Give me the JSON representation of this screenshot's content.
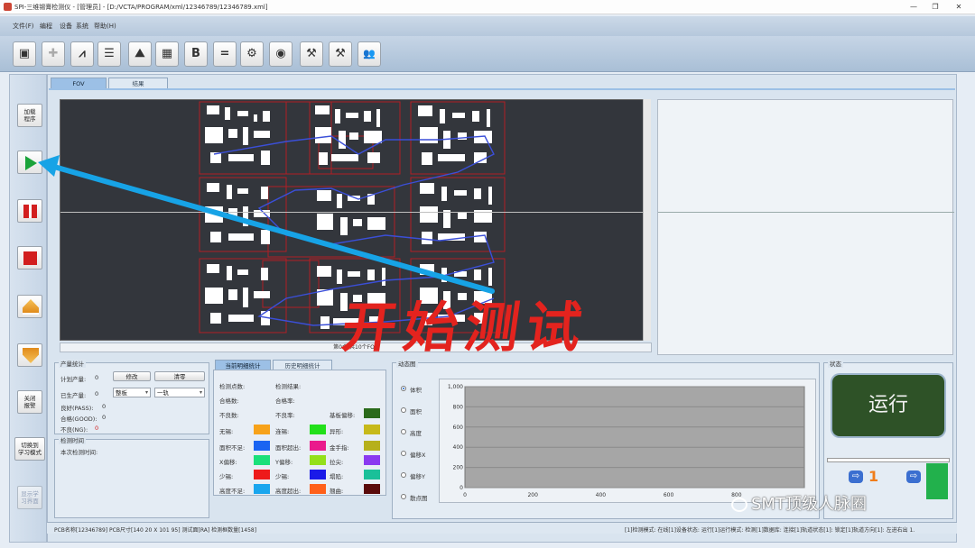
{
  "window": {
    "title": "SPI-三维锡膏检测仪 - [管理员] - [D:/VCTA/PROGRAM/xml/12346789/12346789.xml]",
    "minimize": "—",
    "restore": "❐",
    "close": "✕"
  },
  "menu": [
    "文件(F)",
    "编程",
    "设备",
    "系统",
    "帮助(H)"
  ],
  "toolbar": {
    "icons": [
      "terminal-icon",
      "plus-icon",
      "waveform-icon",
      "sliders-icon",
      "stamp-icon",
      "qrcode-icon",
      "barcode-b-icon",
      "equals-icon",
      "gear-icon",
      "camera-icon",
      "sys-tools-icon",
      "tools-icon",
      "users-icon"
    ],
    "glyphs": [
      "▣",
      "✚",
      "⩘",
      "☰",
      "⛰",
      "▦",
      "B",
      "=",
      "⚙",
      "◉",
      "⚒",
      "⚒",
      "👥"
    ]
  },
  "left_panel": {
    "load_program": "加载\n程序",
    "close_alarm": "关闭\n报警",
    "switch_learn": "切换到\n学习模式",
    "show_learn": "显示学\n习界面"
  },
  "tabs": {
    "fov": "FOV",
    "result": "结果"
  },
  "canvas": {
    "status": "第0个/共10个FOV"
  },
  "overlay": {
    "text": "开始测试"
  },
  "production": {
    "title": "产量统计",
    "plan_label": "计划产量:",
    "plan_value": "0",
    "produced_label": "已生产量:",
    "produced_value": "0",
    "good_label": "良好(PASS):",
    "good_value": "0",
    "ok_label": "合格(GOOD):",
    "ok_value": "0",
    "ng_label": "不良(NG):",
    "ng_value": "0",
    "modify_btn": "修改",
    "clear_btn": "清零",
    "board_combo": "整板",
    "rail_combo": "一轨"
  },
  "inspect_time": {
    "title": "检测时间",
    "this_label": "本次检测时间:"
  },
  "stat_tabs": {
    "current": "当前明细统计",
    "history": "历史明细统计"
  },
  "stats": {
    "points_label": "检测点数:",
    "result_label": "检测结果:",
    "good_count_label": "合格数:",
    "good_rate_label": "合格率:",
    "bad_count_label": "不良数:",
    "bad_rate_label": "不良率:",
    "offset_label": "基板偏移:",
    "defects": [
      {
        "label": "无锡:",
        "color": "#f7a21a"
      },
      {
        "label": "连锡:",
        "color": "#22e01a"
      },
      {
        "label": "异形:",
        "color": "#c7b91a"
      },
      {
        "label": "面积不足:",
        "color": "#1a64f2"
      },
      {
        "label": "面积超出:",
        "color": "#ea1a8c"
      },
      {
        "label": "金手指:",
        "color": "#b6b01a"
      },
      {
        "label": "X偏移:",
        "color": "#1ae07a"
      },
      {
        "label": "Y偏移:",
        "color": "#94e01a"
      },
      {
        "label": "拉尖:",
        "color": "#8a3af0"
      },
      {
        "label": "少锡:",
        "color": "#ee1a1a"
      },
      {
        "label": "少锡:",
        "color": "#1a1ae8"
      },
      {
        "label": "塌陷:",
        "color": "#1ac099"
      },
      {
        "label": "高度不足:",
        "color": "#1aa6ee"
      },
      {
        "label": "高度超出:",
        "color": "#ff601a"
      },
      {
        "label": "翘曲:",
        "color": "#5a0a0a"
      }
    ],
    "offset_color": "#2a6a1a"
  },
  "dynamic": {
    "title": "动态图",
    "options": [
      "体积",
      "面积",
      "高度",
      "偏移X",
      "偏移Y",
      "散点图"
    ],
    "selected": 0
  },
  "chart_data": {
    "type": "line",
    "x_ticks": [
      "0",
      "200",
      "400",
      "600",
      "800"
    ],
    "y_ticks": [
      "1,000",
      "800",
      "600",
      "400",
      "200",
      "0"
    ],
    "ylim": [
      0,
      1000
    ],
    "xlim": [
      0,
      1000
    ],
    "series": []
  },
  "state": {
    "title": "状态",
    "run_label": "运行",
    "counter": "1",
    "bar_color": "#22b14c"
  },
  "statusbar": {
    "left": "PCB名称[12346789] PCB尺寸[140 20 X 101 95] 测试面[RA] 检测框数量[1458]",
    "right": "[1]检测模式: 在线[1]设备状态: 运行[1]运行模式: 检测[1]数据库: 连接[1]轨道状态[1]: 锁定[1]轨道方向[1]: 左进右出   1."
  },
  "watermark": "SMT顶级人脉圈"
}
